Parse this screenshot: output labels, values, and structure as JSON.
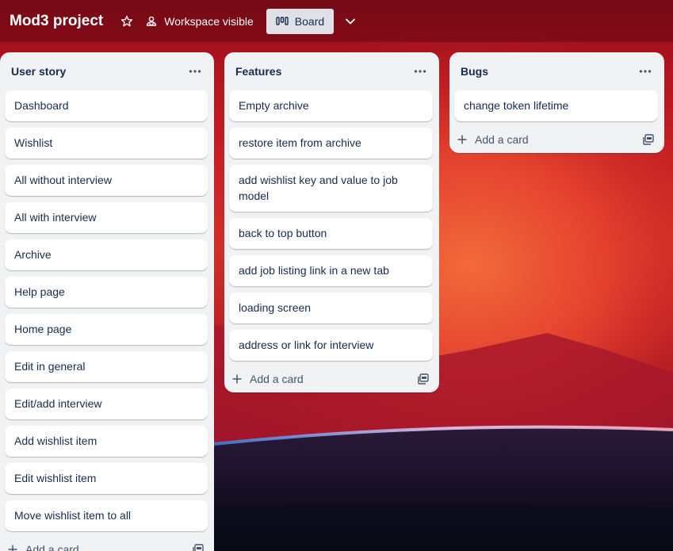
{
  "board": {
    "title": "Mod3 project",
    "visibility_label": "Workspace visible",
    "view_label": "Board",
    "colors": {
      "header_overlay": "#5a050f",
      "list_bg": "#f1f2f4",
      "card_bg": "#ffffff",
      "text": "#172b4d",
      "muted": "#44546f"
    },
    "icons": {
      "star": "star-icon",
      "visibility": "people-icon",
      "view": "board-icon",
      "chevron": "chevron-down-icon"
    }
  },
  "lists": [
    {
      "title": "User story",
      "cards": [
        "Dashboard",
        "Wishlist",
        "All without interview",
        "All with interview",
        "Archive",
        "Help page",
        "Home page",
        "Edit in general",
        "Edit/add interview",
        "Add wishlist item",
        "Edit wishlist item",
        "Move wishlist item to all"
      ],
      "add_label": "Add a card"
    },
    {
      "title": "Features",
      "cards": [
        "Empty archive",
        "restore item from archive",
        "add wishlist key and value to job model",
        "back to top button",
        "add job listing link in a new tab",
        "loading screen",
        "address or link for interview"
      ],
      "add_label": "Add a card"
    },
    {
      "title": "Bugs",
      "cards": [
        "change token lifetime"
      ],
      "add_label": "Add a card"
    }
  ]
}
